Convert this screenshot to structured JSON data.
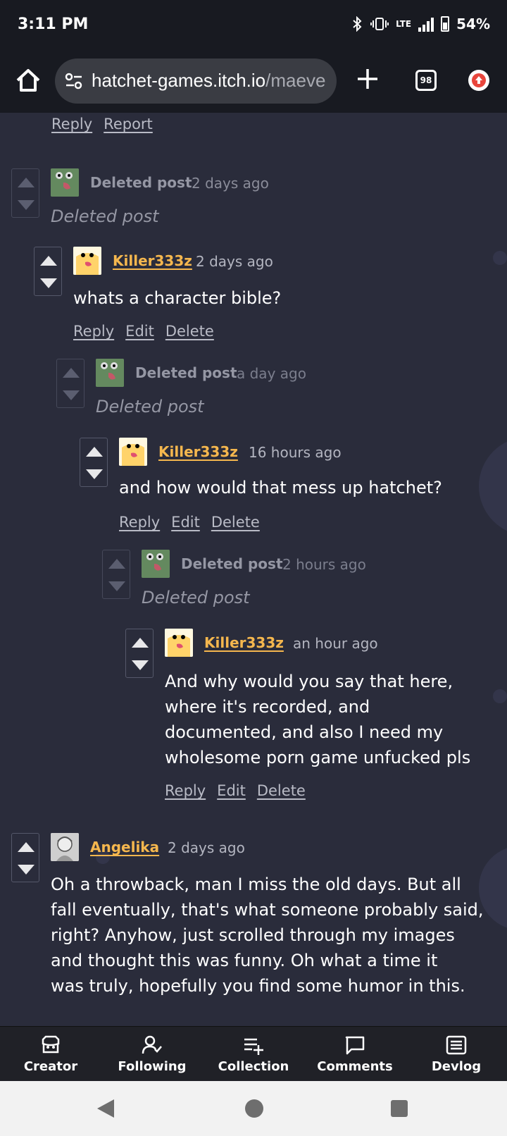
{
  "status_bar": {
    "time": "3:11 PM",
    "network": "LTE",
    "battery": "54%"
  },
  "browser": {
    "url_main": "hatchet-games.itch.io",
    "url_rest": "/maeve",
    "tab_count": "98"
  },
  "top_links": {
    "reply": "Reply",
    "report": "Report"
  },
  "comments": [
    {
      "author": "Deleted post",
      "time": "2 days ago",
      "body": "Deleted post",
      "avatar": "frog-icon"
    },
    {
      "author": "Killer333z",
      "time": "2 days ago",
      "body": "whats a character bible?",
      "avatar": "duck-icon",
      "actions": [
        "Reply",
        "Edit",
        "Delete"
      ]
    },
    {
      "author": "Deleted post",
      "time": "a day ago",
      "body": "Deleted post",
      "avatar": "frog-icon"
    },
    {
      "author": "Killer333z",
      "time": "16 hours ago",
      "body": "and how would that mess up hatchet?",
      "avatar": "duck-icon",
      "actions": [
        "Reply",
        "Edit",
        "Delete"
      ]
    },
    {
      "author": "Deleted post",
      "time": "2 hours ago",
      "body": "Deleted post",
      "avatar": "frog-icon"
    },
    {
      "author": "Killer333z",
      "time": "an hour ago",
      "body_lines": [
        "And why would you say that here,",
        "where it's recorded, and",
        "documented, and also I need my",
        "wholesome porn game unfucked pls"
      ],
      "avatar": "duck-icon",
      "actions": [
        "Reply",
        "Edit",
        "Delete"
      ]
    },
    {
      "author": "Angelika",
      "time": "2 days ago",
      "body_lines": [
        "Oh a throwback, man I miss the old days. But all",
        "fall eventually, that's what someone probably said,",
        "right? Anyhow, just scrolled through my images",
        "and thought this was funny. Oh what a time it",
        "was truly, hopefully you find some humor in this."
      ],
      "avatar": "anime-avatar-icon"
    }
  ],
  "bottom_nav": [
    {
      "label": "Creator",
      "icon": "creator-icon"
    },
    {
      "label": "Following",
      "icon": "following-icon"
    },
    {
      "label": "Collection",
      "icon": "collection-icon"
    },
    {
      "label": "Comments",
      "icon": "comments-icon"
    },
    {
      "label": "Devlog",
      "icon": "devlog-icon"
    }
  ],
  "colors": {
    "background": "#2a2c3b",
    "username": "#f5b74e",
    "bar": "#181a21"
  }
}
